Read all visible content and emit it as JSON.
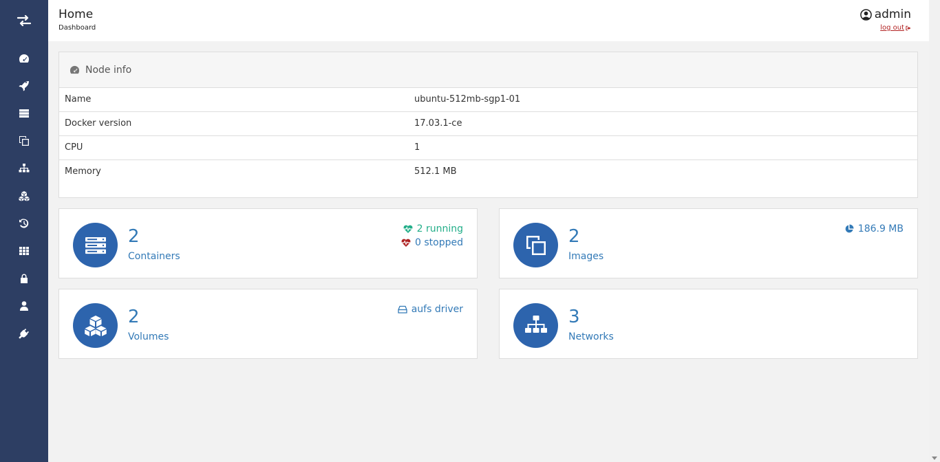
{
  "header": {
    "title": "Home",
    "breadcrumb": "Dashboard",
    "user": "admin",
    "logout": "log out"
  },
  "sidebar": {
    "items": [
      {
        "icon": "tachometer-icon"
      },
      {
        "icon": "rocket-icon"
      },
      {
        "icon": "server-icon"
      },
      {
        "icon": "clone-icon"
      },
      {
        "icon": "sitemap-icon"
      },
      {
        "icon": "cubes-icon"
      },
      {
        "icon": "history-icon"
      },
      {
        "icon": "th-icon"
      },
      {
        "icon": "lock-icon"
      },
      {
        "icon": "user-icon"
      },
      {
        "icon": "plug-icon"
      }
    ]
  },
  "node_info": {
    "title": "Node info",
    "rows": [
      {
        "key": "Name",
        "value": "ubuntu-512mb-sgp1-01"
      },
      {
        "key": "Docker version",
        "value": "17.03.1-ce"
      },
      {
        "key": "CPU",
        "value": "1"
      },
      {
        "key": "Memory",
        "value": "512.1 MB"
      }
    ]
  },
  "cards": {
    "containers": {
      "count": "2",
      "label": "Containers",
      "running": "2 running",
      "stopped": "0 stopped"
    },
    "images": {
      "count": "2",
      "label": "Images",
      "size": "186.9 MB"
    },
    "volumes": {
      "count": "2",
      "label": "Volumes",
      "driver": "aufs driver"
    },
    "networks": {
      "count": "3",
      "label": "Networks"
    }
  },
  "colors": {
    "sidebar": "#2d3e63",
    "accent": "#2d64ad",
    "link": "#337ab7",
    "running": "#23ae89",
    "stopped": "#ae2323",
    "logout": "#b22222"
  }
}
